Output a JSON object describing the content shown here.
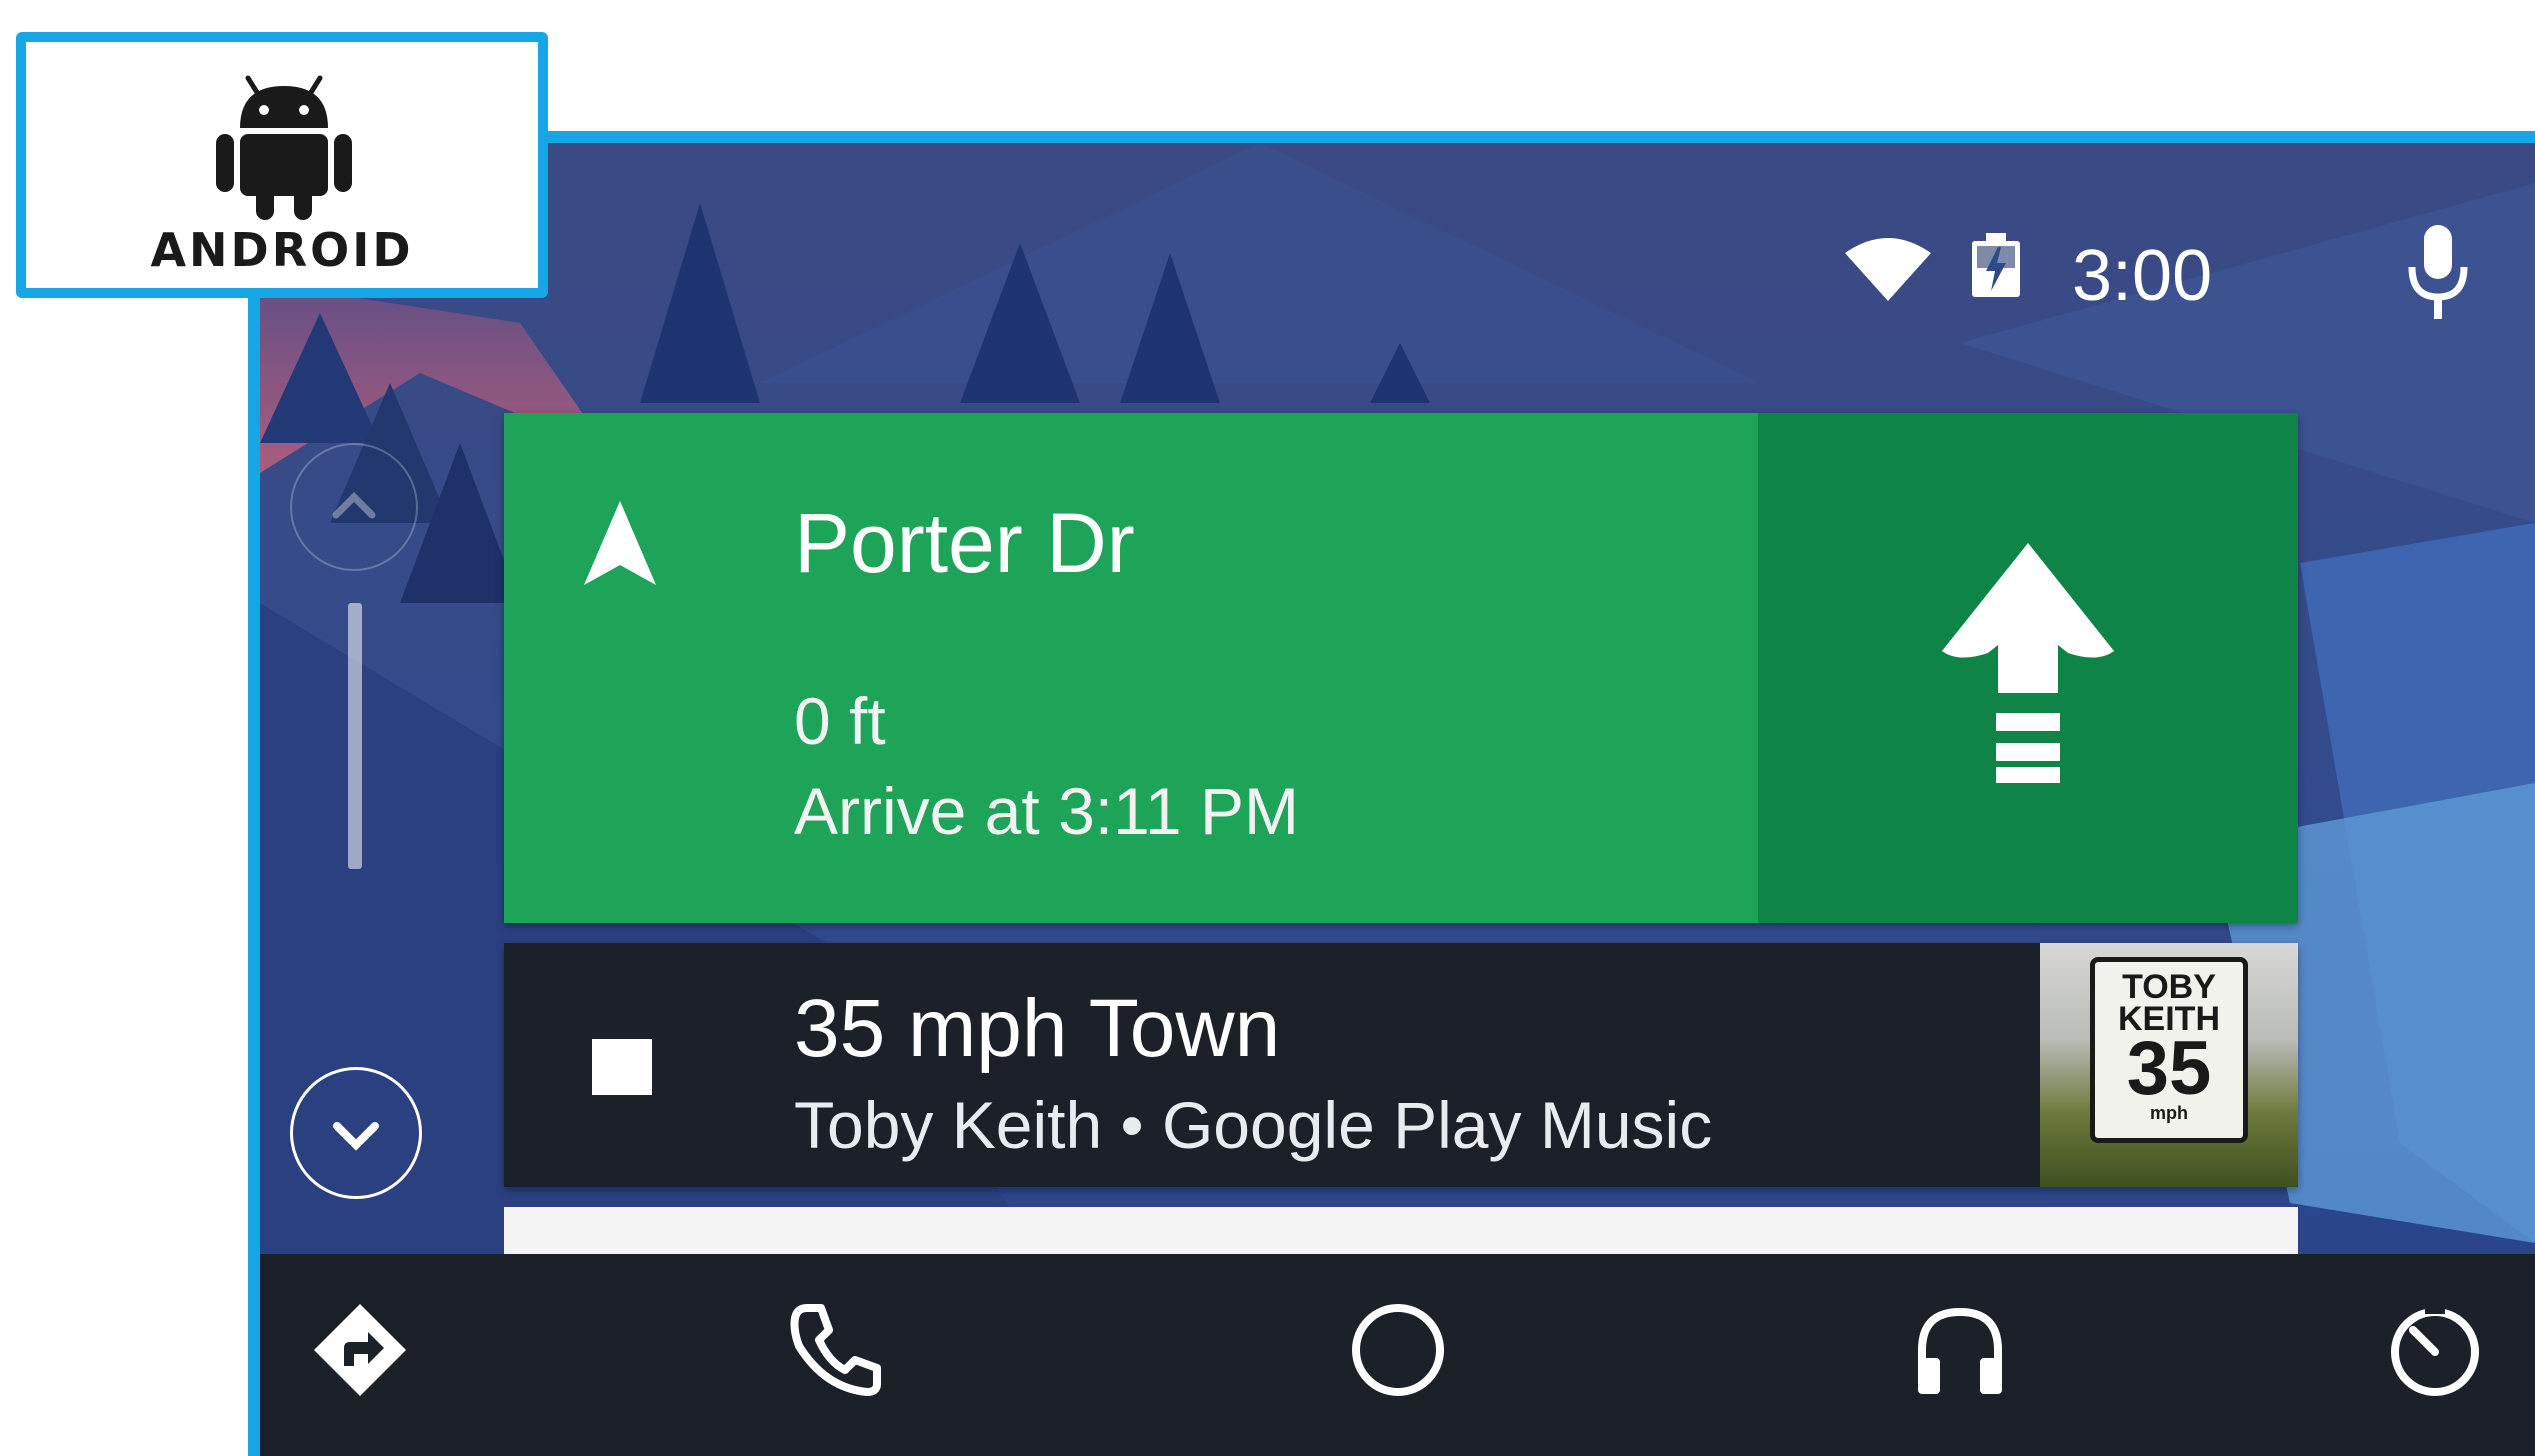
{
  "brand": {
    "logo_text": "ANDROID",
    "accent_color": "#16a6e6"
  },
  "status_bar": {
    "time": "3:00",
    "icons": [
      "wifi-icon",
      "battery-charging-icon",
      "mic-icon"
    ]
  },
  "navigation_card": {
    "street": "Porter Dr",
    "distance": "0 ft",
    "eta": "Arrive at 3:11 PM",
    "maneuver_icon": "straight-arrow-icon",
    "card_color": "#1da459",
    "turn_panel_color": "#0f8447"
  },
  "music_card": {
    "title": "35 mph Town",
    "subtitle": "Toby Keith • Google Play Music",
    "album_art": {
      "line1": "TOBY",
      "line2": "KEITH",
      "number": "35",
      "unit": "mph"
    }
  },
  "bottom_bar": {
    "tabs": [
      {
        "name": "navigation",
        "icon": "directions-icon"
      },
      {
        "name": "phone",
        "icon": "phone-icon"
      },
      {
        "name": "home",
        "icon": "home-circle-icon"
      },
      {
        "name": "audio",
        "icon": "headphones-icon"
      },
      {
        "name": "overview",
        "icon": "speedometer-icon"
      }
    ]
  }
}
